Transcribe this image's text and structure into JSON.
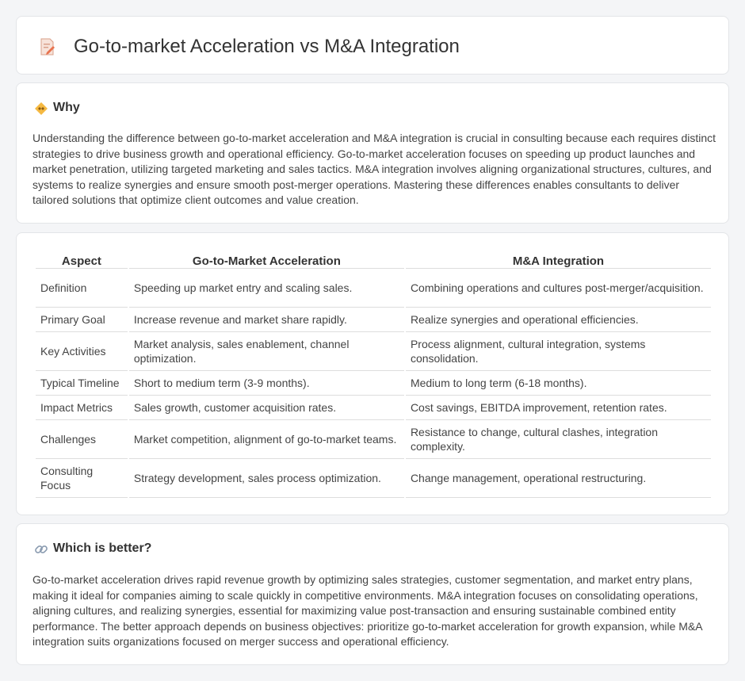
{
  "header": {
    "title": "Go-to-market Acceleration vs M&A Integration",
    "icon": "document-pencil-icon"
  },
  "why": {
    "heading": "Why",
    "icon": "handshake-icon",
    "text": "Understanding the difference between go-to-market acceleration and M&A integration is crucial in consulting because each requires distinct strategies to drive business growth and operational efficiency. Go-to-market acceleration focuses on speeding up product launches and market penetration, utilizing targeted marketing and sales tactics. M&A integration involves aligning organizational structures, cultures, and systems to realize synergies and ensure smooth post-merger operations. Mastering these differences enables consultants to deliver tailored solutions that optimize client outcomes and value creation."
  },
  "comparison": {
    "headers": [
      "Aspect",
      "Go-to-Market Acceleration",
      "M&A Integration"
    ],
    "rows": [
      [
        "Definition",
        "Speeding up market entry and scaling sales.",
        "Combining operations and cultures post-merger/acquisition."
      ],
      [
        "Primary Goal",
        "Increase revenue and market share rapidly.",
        "Realize synergies and operational efficiencies."
      ],
      [
        "Key Activities",
        "Market analysis, sales enablement, channel optimization.",
        "Process alignment, cultural integration, systems consolidation."
      ],
      [
        "Typical Timeline",
        "Short to medium term (3-9 months).",
        "Medium to long term (6-18 months)."
      ],
      [
        "Impact Metrics",
        "Sales growth, customer acquisition rates.",
        "Cost savings, EBITDA improvement, retention rates."
      ],
      [
        "Challenges",
        "Market competition, alignment of go-to-market teams.",
        "Resistance to change, cultural clashes, integration complexity."
      ],
      [
        "Consulting Focus",
        "Strategy development, sales process optimization.",
        "Change management, operational restructuring."
      ]
    ]
  },
  "better": {
    "heading": "Which is better?",
    "icon": "link-icon",
    "text": "Go-to-market acceleration drives rapid revenue growth by optimizing sales strategies, customer segmentation, and market entry plans, making it ideal for companies aiming to scale quickly in competitive environments. M&A integration focuses on consolidating operations, aligning cultures, and realizing synergies, essential for maximizing value post-transaction and ensuring sustainable combined entity performance. The better approach depends on business objectives: prioritize go-to-market acceleration for growth expansion, while M&A integration suits organizations focused on merger success and operational efficiency."
  }
}
